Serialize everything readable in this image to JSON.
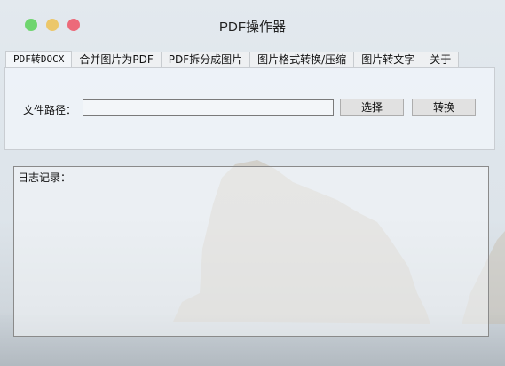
{
  "window": {
    "title": "PDF操作器"
  },
  "tabs": [
    {
      "label": "PDF转DOCX",
      "active": true
    },
    {
      "label": "合并图片为PDF",
      "active": false
    },
    {
      "label": "PDF拆分成图片",
      "active": false
    },
    {
      "label": "图片格式转换/压缩",
      "active": false
    },
    {
      "label": "图片转文字",
      "active": false
    },
    {
      "label": "关于",
      "active": false
    }
  ],
  "panel": {
    "path_label": "文件路径：",
    "path_value": "",
    "select_button": "选择",
    "convert_button": "转换"
  },
  "log": {
    "label": "日志记录："
  },
  "colors": {
    "close": "#6fd56f",
    "minimize": "#ecc76a",
    "maximize": "#ec6a7a"
  }
}
